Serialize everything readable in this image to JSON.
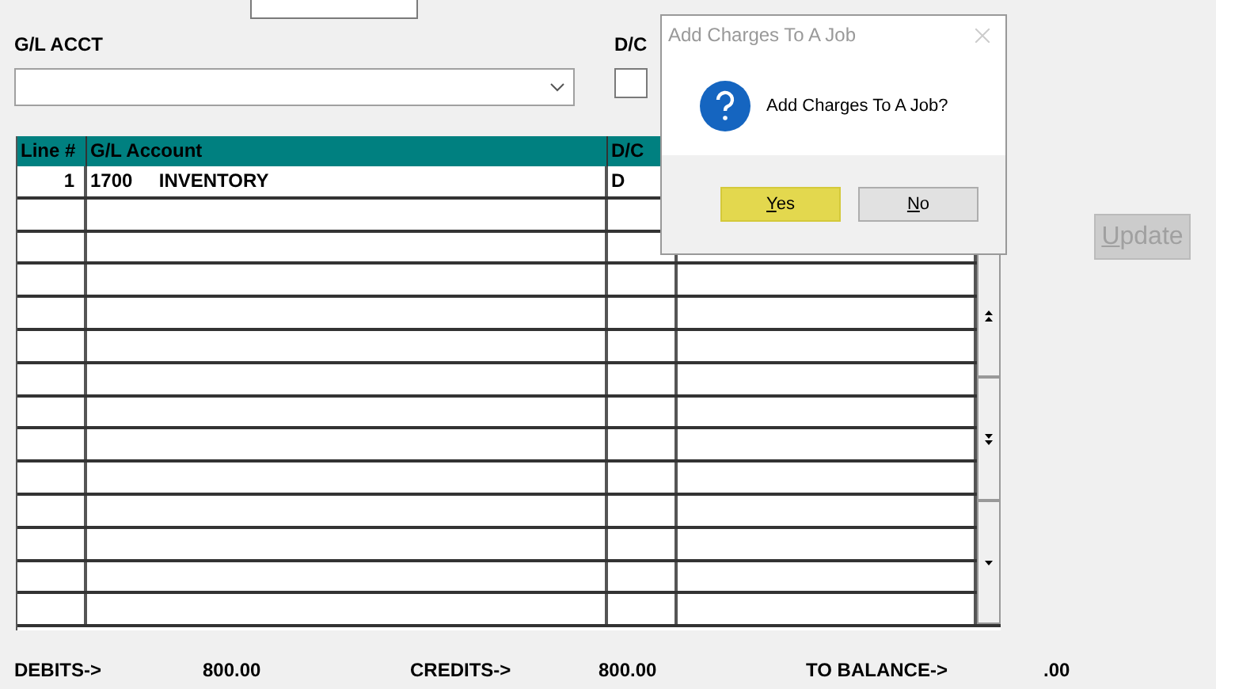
{
  "form": {
    "gl_acct_label": "G/L ACCT",
    "dc_label": "D/C"
  },
  "table": {
    "columns": [
      "Line #",
      "G/L Account",
      "D/C"
    ],
    "rows": [
      [
        "1",
        "1700     INVENTORY",
        "D"
      ]
    ]
  },
  "update_button": {
    "label": "Update",
    "disabled": true
  },
  "totals": [
    {
      "label": "DEBITS->",
      "value": "800.00"
    },
    {
      "label": "CREDITS->",
      "value": "800.00"
    },
    {
      "label": "TO BALANCE->",
      "value": ".00"
    }
  ],
  "dialog": {
    "title": "Add Charges To A Job",
    "message": "Add Charges To A Job?",
    "buttons": [
      {
        "label": "Yes",
        "selected": true
      },
      {
        "label": "No",
        "selected": false
      }
    ]
  }
}
